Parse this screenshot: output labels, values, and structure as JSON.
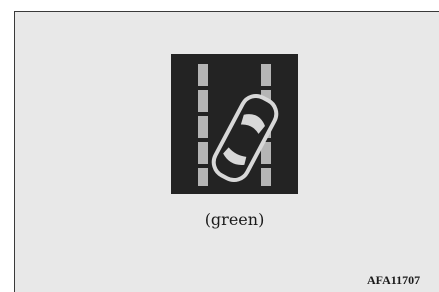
{
  "figure": {
    "icon": "lane-departure-warning-icon",
    "indicator_color_name": "green",
    "caption": "(green)",
    "code": "AFA11707"
  },
  "colors": {
    "frame_background": "#e8e8e8",
    "panel_background": "#232323",
    "lane_marking": "#b5b5b5",
    "car_outline": "#d8d8d8",
    "text": "#1a1a1a"
  }
}
